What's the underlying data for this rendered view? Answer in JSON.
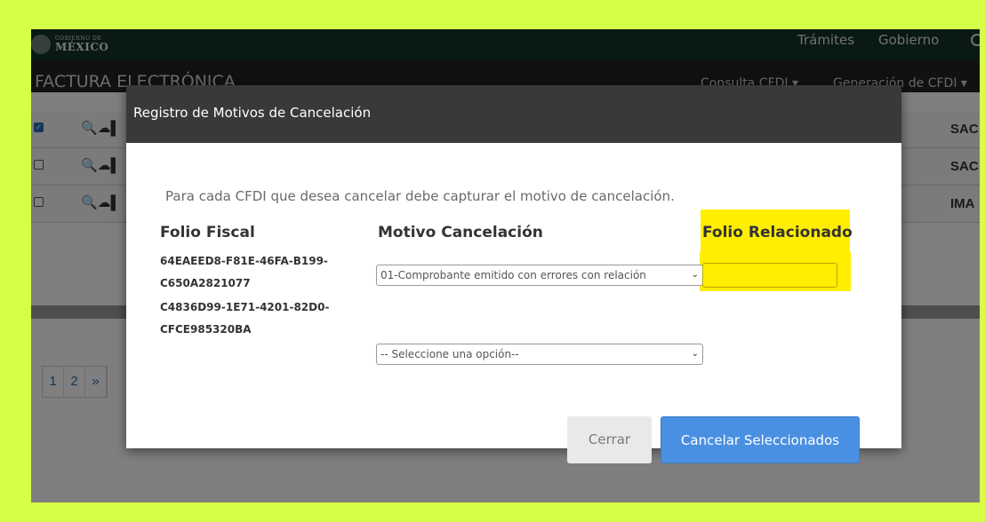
{
  "colors": {
    "frame": "#d6ff47",
    "highlight": "#ffee00",
    "primary": "#4a90e2",
    "header": "#393939"
  },
  "gov": {
    "logo_small": "GOBIERNO DE",
    "logo_big": "MÉXICO",
    "links": [
      "Trámites",
      "Gobierno"
    ],
    "search_icon": "search-icon"
  },
  "app": {
    "title": "FACTURA ELECTRÓNICA",
    "menus": [
      "Consulta CFDI ▾",
      "Generación de CFDI ▾"
    ]
  },
  "background_table": {
    "rows": [
      {
        "checked": true,
        "code": "SAC"
      },
      {
        "checked": false,
        "code": "SAC"
      },
      {
        "checked": false,
        "code": "IMA"
      }
    ],
    "pager": [
      "1",
      "2",
      "»"
    ]
  },
  "modal": {
    "title": "Registro de Motivos de Cancelación",
    "instructions": "Para cada CFDI que desea cancelar debe capturar el motivo de cancelación.",
    "headers": {
      "folio_fiscal": "Folio Fiscal",
      "motivo": "Motivo Cancelación",
      "folio_relacionado": "Folio Relacionado"
    },
    "rows": [
      {
        "uuid_line1": "64EAEED8-F81E-46FA-B199-",
        "uuid_line2": "C650A2821077",
        "motivo_selected": "01-Comprobante emitido con errores con relación",
        "folio_relacionado_value": ""
      },
      {
        "uuid_line1": "C4836D99-1E71-4201-82D0-",
        "uuid_line2": "CFCE985320BA",
        "motivo_selected": "-- Seleccione una opción--"
      }
    ],
    "buttons": {
      "close": "Cerrar",
      "submit": "Cancelar Seleccionados"
    }
  }
}
